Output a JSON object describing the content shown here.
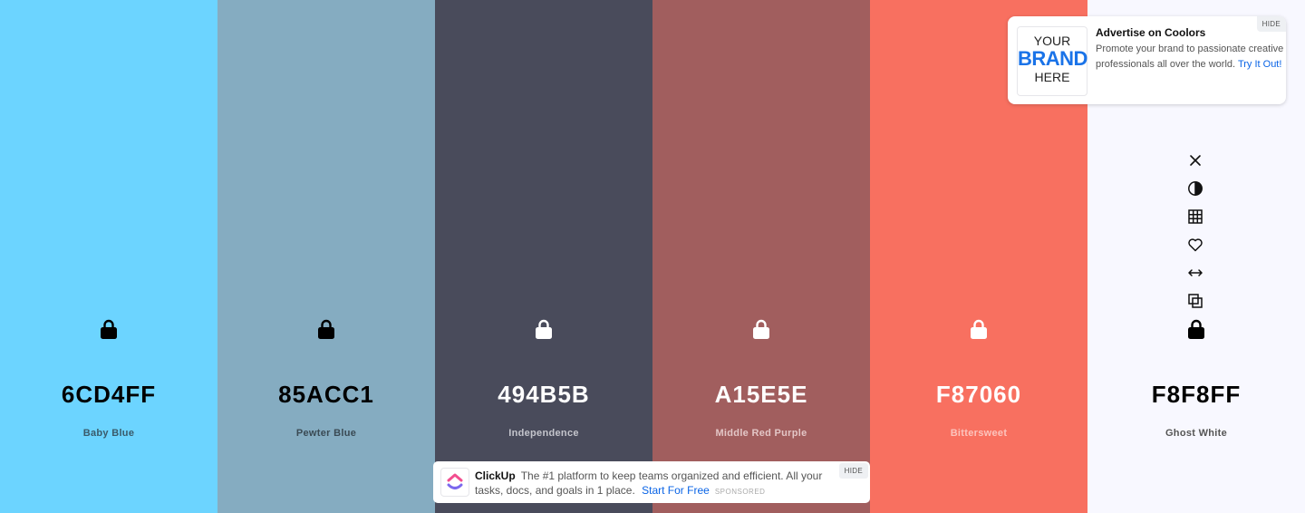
{
  "swatches": [
    {
      "hex": "6CD4FF",
      "name": "Baby Blue",
      "bg": "#6CD4FF",
      "fg": "#000000",
      "sub": "#3a5a6a"
    },
    {
      "hex": "85ACC1",
      "name": "Pewter Blue",
      "bg": "#85ACC1",
      "fg": "#000000",
      "sub": "#3a4a54"
    },
    {
      "hex": "494B5B",
      "name": "Independence",
      "bg": "#494B5B",
      "fg": "#ffffff",
      "sub": "#c4c5cc"
    },
    {
      "hex": "A15E5E",
      "name": "Middle Red Purple",
      "bg": "#A15E5E",
      "fg": "#ffffff",
      "sub": "#e3c6c6"
    },
    {
      "hex": "F87060",
      "name": "Bittersweet",
      "bg": "#F87060",
      "fg": "#ffffff",
      "sub": "#fcc4bd"
    },
    {
      "hex": "F8F8FF",
      "name": "Ghost White",
      "bg": "#F8F8FF",
      "fg": "#000000",
      "sub": "#555555"
    }
  ],
  "tools": {
    "icons": [
      "close-icon",
      "contrast-icon",
      "shades-grid-icon",
      "heart-icon",
      "drag-arrows-icon",
      "copy-icon"
    ]
  },
  "ad_top": {
    "logo_line1": "YOUR",
    "logo_line2": "BRAND",
    "logo_line3": "HERE",
    "title": "Advertise on Coolors",
    "body": "Promote your brand to passionate creative professionals all over the world.",
    "link": "Try It Out!",
    "hide": "HIDE"
  },
  "ad_bottom": {
    "brand": "ClickUp",
    "text": "The #1 platform to keep teams organized and efficient. All your tasks, docs, and goals in 1 place.",
    "link": "Start For Free",
    "sponsored": "SPONSORED",
    "hide": "HIDE"
  }
}
